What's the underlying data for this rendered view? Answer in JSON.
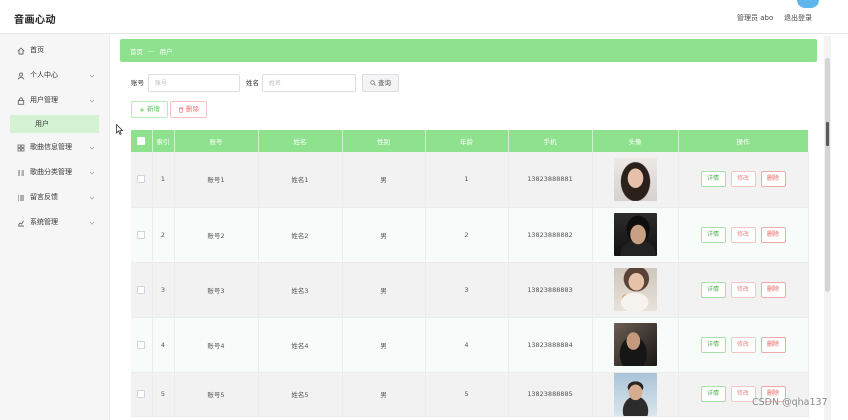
{
  "app": {
    "title": "音画心动"
  },
  "header": {
    "user": "管理员 abo",
    "logout": "退出登录"
  },
  "sidebar": {
    "items": [
      {
        "label": "首页",
        "icon": "home-icon"
      },
      {
        "label": "个人中心",
        "icon": "user-icon",
        "expandable": true
      },
      {
        "label": "用户管理",
        "icon": "lock-icon",
        "expandable": true,
        "expanded": true,
        "children": [
          {
            "label": "用户",
            "selected": true
          }
        ]
      },
      {
        "label": "歌曲信息管理",
        "icon": "grid-icon",
        "expandable": true
      },
      {
        "label": "歌曲分类管理",
        "icon": "category-icon",
        "expandable": true
      },
      {
        "label": "留言反馈",
        "icon": "message-icon",
        "expandable": true
      },
      {
        "label": "系统管理",
        "icon": "chart-icon",
        "expandable": true
      }
    ]
  },
  "breadcrumb": {
    "items": [
      "首页",
      "用户"
    ],
    "separator": "—"
  },
  "search": {
    "account_label": "账号",
    "account_placeholder": "账号",
    "name_label": "姓名",
    "name_placeholder": "姓名",
    "query_button": "查询",
    "query_icon": "search-icon"
  },
  "toolbar": {
    "add_button": "新增",
    "add_icon": "plus-icon",
    "delete_button": "删除",
    "delete_icon": "trash-icon"
  },
  "table": {
    "columns": [
      "索引",
      "账号",
      "姓名",
      "性别",
      "年龄",
      "手机",
      "头像",
      "操作"
    ],
    "row_actions": {
      "detail": "详情",
      "edit": "修改",
      "delete": "删除"
    },
    "rows": [
      {
        "index": "1",
        "account": "账号1",
        "name": "姓名1",
        "gender": "男",
        "age": "1",
        "phone": "13823888881"
      },
      {
        "index": "2",
        "account": "账号2",
        "name": "姓名2",
        "gender": "男",
        "age": "2",
        "phone": "13823888882"
      },
      {
        "index": "3",
        "account": "账号3",
        "name": "姓名3",
        "gender": "男",
        "age": "3",
        "phone": "13823888883"
      },
      {
        "index": "4",
        "account": "账号4",
        "name": "姓名4",
        "gender": "男",
        "age": "4",
        "phone": "13823888884"
      },
      {
        "index": "5",
        "account": "账号5",
        "name": "姓名5",
        "gender": "男",
        "age": "5",
        "phone": "13823888885"
      }
    ]
  },
  "watermark": "CSDN @qha137",
  "colors": {
    "accent": "#8ee28e",
    "selected_menu_bg": "#d4f3d4",
    "success": "#4fb24f",
    "danger": "#e35f5f"
  }
}
